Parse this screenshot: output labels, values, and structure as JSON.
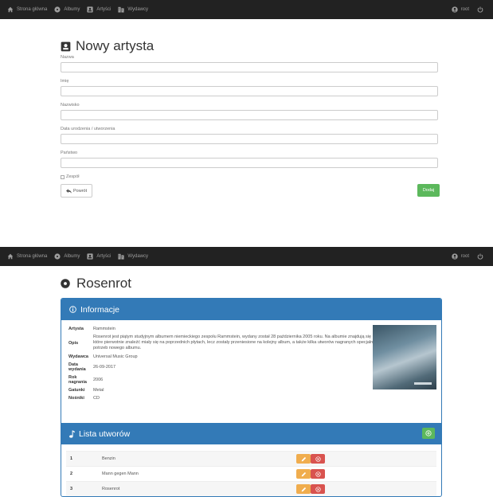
{
  "nav": {
    "home": "Strona główna",
    "albums": "Albumy",
    "artists": "Artyści",
    "publishers": "Wydawcy",
    "user": "root"
  },
  "form": {
    "title": "Nowy artysta",
    "fields": {
      "name": "Nazwa",
      "first_name": "Imię",
      "last_name": "Nazwisko",
      "birth_date": "Data urodzenia / utworzenia",
      "country": "Państwo"
    },
    "band_checkbox": "Zespół",
    "back_button": "Powrót",
    "add_button": "Dodaj"
  },
  "album": {
    "title": "Rosenrot",
    "info_header": "Informacje",
    "rows": [
      {
        "key": "Artysta",
        "value": "Rammstein"
      },
      {
        "key": "Opis",
        "value": "Rosenrot jest piątym studyjnym albumem niemieckiego zespołu Rammstein, wydany został 28 października 2005 roku. Na albumie znajdują się utwory, które pierwotnie znaleźć miały się na poprzednich płytach, lecz zostały przeniesione na kolejny album, a także kilka utworów nagranych specjalnie dla potrzeb nowego albumu."
      },
      {
        "key": "Wydawca",
        "value": "Universal Music Group"
      },
      {
        "key": "Data wydania",
        "value": "26-09-2017"
      },
      {
        "key": "Rok nagrania",
        "value": "2006"
      },
      {
        "key": "Gatunki",
        "value": "Metal"
      },
      {
        "key": "Nośniki",
        "value": "CD"
      }
    ],
    "tracks_header": "Lista utworów",
    "tracks": [
      {
        "num": "1",
        "title": "Benzin"
      },
      {
        "num": "2",
        "title": "Mann gegen Mann"
      },
      {
        "num": "3",
        "title": "Rosenrot"
      }
    ]
  },
  "colors": {
    "navbar": "#222222",
    "primary": "#337ab7",
    "success": "#5cb85c",
    "warning": "#f0ad4e",
    "danger": "#d9534f"
  }
}
